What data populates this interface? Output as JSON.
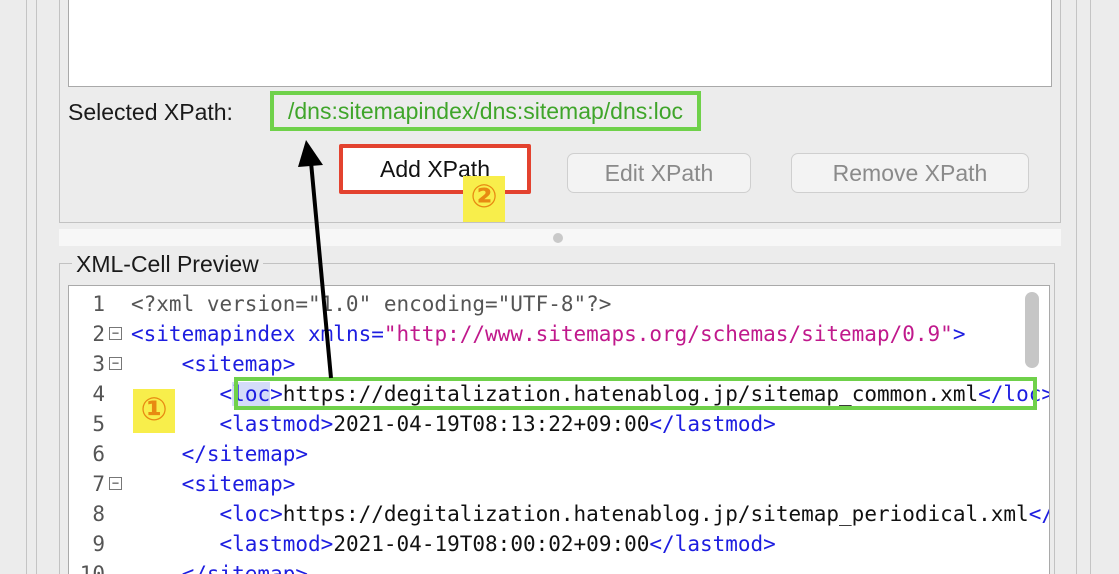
{
  "xpath": {
    "selected_label": "Selected XPath:",
    "selected_value": "/dns:sitemapindex/dns:sitemap/dns:loc",
    "add_label": "Add XPath",
    "edit_label": "Edit XPath",
    "remove_label": "Remove XPath"
  },
  "annotations": {
    "step1": "①",
    "step2": "②"
  },
  "preview": {
    "title": "XML-Cell Preview",
    "lines": [
      {
        "n": "1",
        "indent": "",
        "parts": [
          [
            "gray",
            "<?xml version=\"1.0\" encoding=\"UTF-8\"?>"
          ]
        ]
      },
      {
        "n": "2",
        "indent": "",
        "fold": "−",
        "parts": [
          [
            "tag",
            "<sitemapindex "
          ],
          [
            "attr",
            "xmlns="
          ],
          [
            "str",
            "\"http://www.sitemaps.org/schemas/sitemap/0.9\""
          ],
          [
            "tag",
            ">"
          ]
        ]
      },
      {
        "n": "3",
        "indent": "    ",
        "fold": "−",
        "parts": [
          [
            "tag",
            "<sitemap>"
          ]
        ]
      },
      {
        "n": "4",
        "indent": "       ",
        "parts": [
          [
            "tag",
            "<"
          ],
          [
            "hl",
            "loc"
          ],
          [
            "tag",
            ">"
          ],
          [
            "text",
            "https://degitalization.hatenablog.jp/sitemap_common.xml"
          ],
          [
            "tag",
            "</loc>"
          ]
        ]
      },
      {
        "n": "5",
        "indent": "       ",
        "parts": [
          [
            "tag",
            "<lastmod>"
          ],
          [
            "text",
            "2021-04-19T08:13:22+09:00"
          ],
          [
            "tag",
            "</lastmod>"
          ]
        ]
      },
      {
        "n": "6",
        "indent": "    ",
        "parts": [
          [
            "tag",
            "</sitemap>"
          ]
        ]
      },
      {
        "n": "7",
        "indent": "    ",
        "fold": "−",
        "parts": [
          [
            "tag",
            "<sitemap>"
          ]
        ]
      },
      {
        "n": "8",
        "indent": "       ",
        "parts": [
          [
            "tag",
            "<loc>"
          ],
          [
            "text",
            "https://degitalization.hatenablog.jp/sitemap_periodical.xml"
          ],
          [
            "tag",
            "</loc>"
          ]
        ]
      },
      {
        "n": "9",
        "indent": "       ",
        "parts": [
          [
            "tag",
            "<lastmod>"
          ],
          [
            "text",
            "2021-04-19T08:00:02+09:00"
          ],
          [
            "tag",
            "</lastmod>"
          ]
        ]
      },
      {
        "n": "10",
        "indent": "    ",
        "parts": [
          [
            "tag",
            "</sitemap>"
          ]
        ]
      }
    ]
  },
  "colors": {
    "highlight_green": "#6fd14a",
    "highlight_red": "#e3422f",
    "badge_yellow": "#f8ee4b"
  }
}
